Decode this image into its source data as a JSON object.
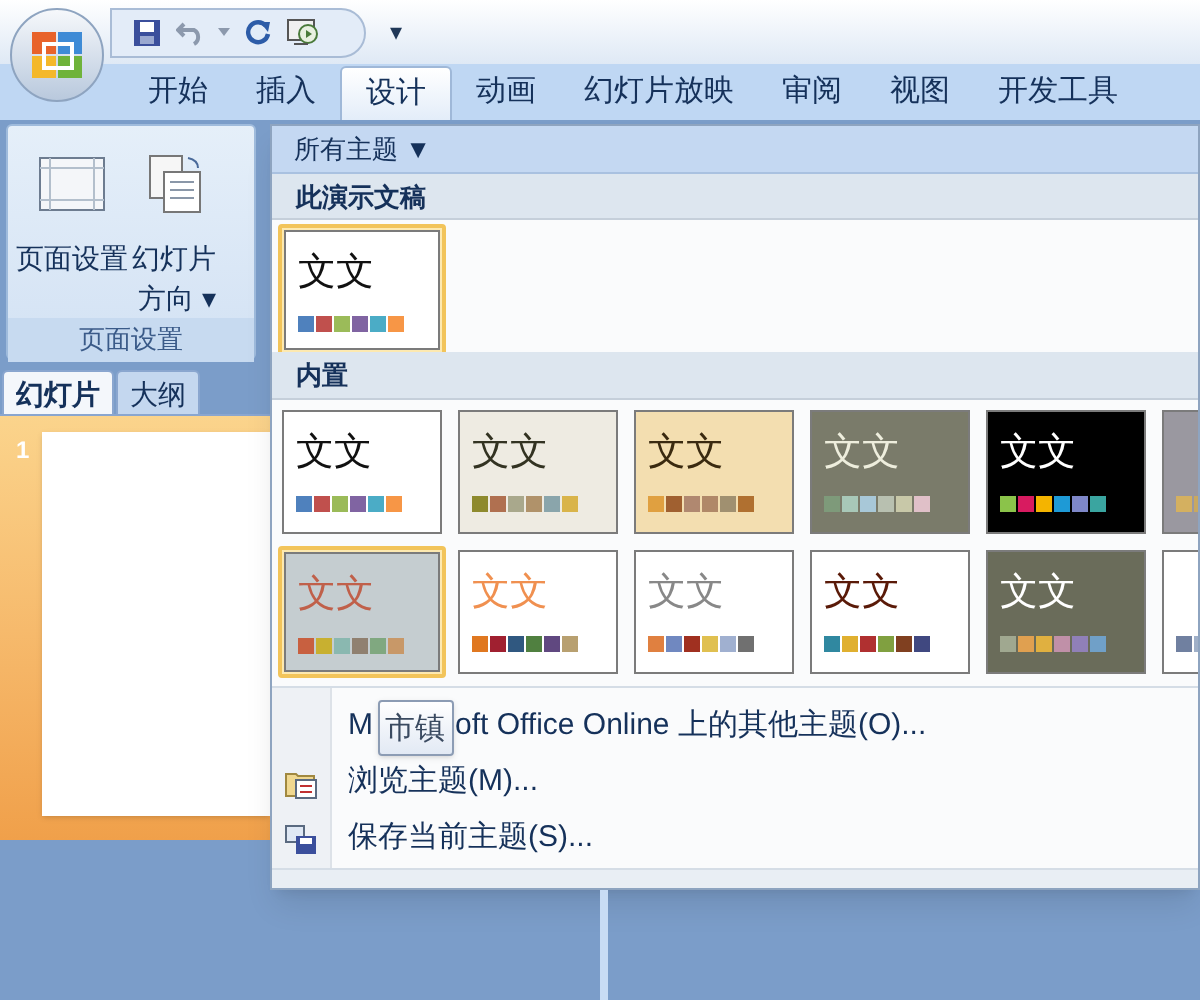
{
  "quick_access": {
    "customize": "▾"
  },
  "tabs": [
    {
      "label": "开始",
      "selected": false
    },
    {
      "label": "插入",
      "selected": false
    },
    {
      "label": "设计",
      "selected": true
    },
    {
      "label": "动画",
      "selected": false
    },
    {
      "label": "幻灯片放映",
      "selected": false
    },
    {
      "label": "审阅",
      "selected": false
    },
    {
      "label": "视图",
      "selected": false
    },
    {
      "label": "开发工具",
      "selected": false
    }
  ],
  "ribbon_group": {
    "buttons": [
      {
        "lines": [
          "页面设置"
        ]
      },
      {
        "lines": [
          "幻灯片",
          "方向 ▾"
        ]
      }
    ],
    "label": "页面设置"
  },
  "pane_tabs": [
    {
      "label": "幻灯片",
      "selected": true
    },
    {
      "label": "大纲",
      "selected": false
    }
  ],
  "slides": [
    {
      "number": "1"
    }
  ],
  "theme_menu": {
    "filter": "所有主题 ▼",
    "current_heading": "此演示文稿",
    "current": [
      {
        "sample": {
          "text": "文文",
          "color": "#111111"
        },
        "color": "#ffffff",
        "selected": true,
        "swatches": [
          {
            "color": "#4f81bd"
          },
          {
            "color": "#c0504d"
          },
          {
            "color": "#9bbb59"
          },
          {
            "color": "#8064a2"
          },
          {
            "color": "#4bacc6"
          },
          {
            "color": "#f79646"
          }
        ]
      }
    ],
    "builtin_heading": "内置",
    "builtin": [
      {
        "sample": {
          "text": "文文",
          "color": "#111111"
        },
        "color": "#ffffff",
        "selected": false,
        "swatches": [
          {
            "color": "#4f81bd"
          },
          {
            "color": "#c0504d"
          },
          {
            "color": "#9bbb59"
          },
          {
            "color": "#8064a2"
          },
          {
            "color": "#4bacc6"
          },
          {
            "color": "#f79646"
          }
        ]
      },
      {
        "sample": {
          "text": "文文",
          "color": "#333322"
        },
        "color": "#eeebe2",
        "selected": false,
        "swatches": [
          {
            "color": "#8e8a2e"
          },
          {
            "color": "#b07050"
          },
          {
            "color": "#a9a88c"
          },
          {
            "color": "#b0926a"
          },
          {
            "color": "#8aa5ab"
          },
          {
            "color": "#d9b44a"
          }
        ]
      },
      {
        "sample": {
          "text": "文文",
          "color": "#3a2a10"
        },
        "color": "#f3deb0",
        "selected": false,
        "swatches": [
          {
            "color": "#e0a040"
          },
          {
            "color": "#a06030"
          },
          {
            "color": "#b08870"
          },
          {
            "color": "#b08868"
          },
          {
            "color": "#a09070"
          },
          {
            "color": "#b07030"
          }
        ]
      },
      {
        "sample": {
          "text": "文文",
          "color": "#eeeedd"
        },
        "color": "#7a7b6a",
        "selected": false,
        "swatches": [
          {
            "color": "#7e9a7a"
          },
          {
            "color": "#a8c8b8"
          },
          {
            "color": "#a8c8d8"
          },
          {
            "color": "#b8c0b0"
          },
          {
            "color": "#c8c8a8"
          },
          {
            "color": "#e0c0c8"
          }
        ]
      },
      {
        "sample": {
          "text": "文文",
          "color": "#ffffff"
        },
        "color": "#000000",
        "selected": false,
        "swatches": [
          {
            "color": "#8bc34a"
          },
          {
            "color": "#d81b60"
          },
          {
            "color": "#f4b400"
          },
          {
            "color": "#1e9ad6"
          },
          {
            "color": "#7e87c8"
          },
          {
            "color": "#3aa5a0"
          }
        ]
      },
      {
        "color": "#9a98a0",
        "selected": false,
        "swatches": [
          {
            "color": "#d4b060"
          },
          {
            "color": "#c8a860"
          }
        ]
      },
      {
        "sample": {
          "text": "文文",
          "color": "#c0604a"
        },
        "color": "#c5cdd0",
        "selected": true,
        "swatches": [
          {
            "color": "#c86040"
          },
          {
            "color": "#c8b030"
          },
          {
            "color": "#8ab8b0"
          },
          {
            "color": "#908070"
          },
          {
            "color": "#80a880"
          },
          {
            "color": "#c89868"
          }
        ]
      },
      {
        "sample": {
          "text": "文文",
          "color": "#f09050"
        },
        "color": "#ffffff",
        "selected": false,
        "swatches": [
          {
            "color": "#e07820"
          },
          {
            "color": "#a02030"
          },
          {
            "color": "#305880"
          },
          {
            "color": "#508040"
          },
          {
            "color": "#604880"
          },
          {
            "color": "#b8a070"
          }
        ]
      },
      {
        "sample": {
          "text": "文文",
          "color": "#888888"
        },
        "color": "#ffffff",
        "selected": false,
        "swatches": [
          {
            "color": "#e08040"
          },
          {
            "color": "#7088c0"
          },
          {
            "color": "#a03020"
          },
          {
            "color": "#e0c050"
          },
          {
            "color": "#a0b0d0"
          },
          {
            "color": "#707070"
          }
        ]
      },
      {
        "sample": {
          "text": "文文",
          "color": "#5a1a08"
        },
        "color": "#ffffff",
        "selected": false,
        "swatches": [
          {
            "color": "#3088a0"
          },
          {
            "color": "#e0b030"
          },
          {
            "color": "#b03030"
          },
          {
            "color": "#80a040"
          },
          {
            "color": "#804020"
          },
          {
            "color": "#404880"
          }
        ]
      },
      {
        "sample": {
          "text": "文文",
          "color": "#ffffff"
        },
        "color": "#6a6c5a",
        "selected": false,
        "swatches": [
          {
            "color": "#a0a890"
          },
          {
            "color": "#e0a050"
          },
          {
            "color": "#e0b040"
          },
          {
            "color": "#c090a8"
          },
          {
            "color": "#9080b8"
          },
          {
            "color": "#70a0c8"
          }
        ]
      },
      {
        "color": "#ffffff",
        "selected": false,
        "swatches": [
          {
            "color": "#7080a0"
          },
          {
            "color": "#a0b0c8"
          }
        ]
      }
    ],
    "commands": [
      {
        "kind": "online",
        "label_start": "M",
        "tooltip": "市镇",
        "label_end": "oft Office Online 上的其他主题(O)..."
      },
      {
        "kind": "browse",
        "label": "浏览主题(M)..."
      },
      {
        "kind": "save",
        "label": "保存当前主题(S)..."
      }
    ]
  }
}
